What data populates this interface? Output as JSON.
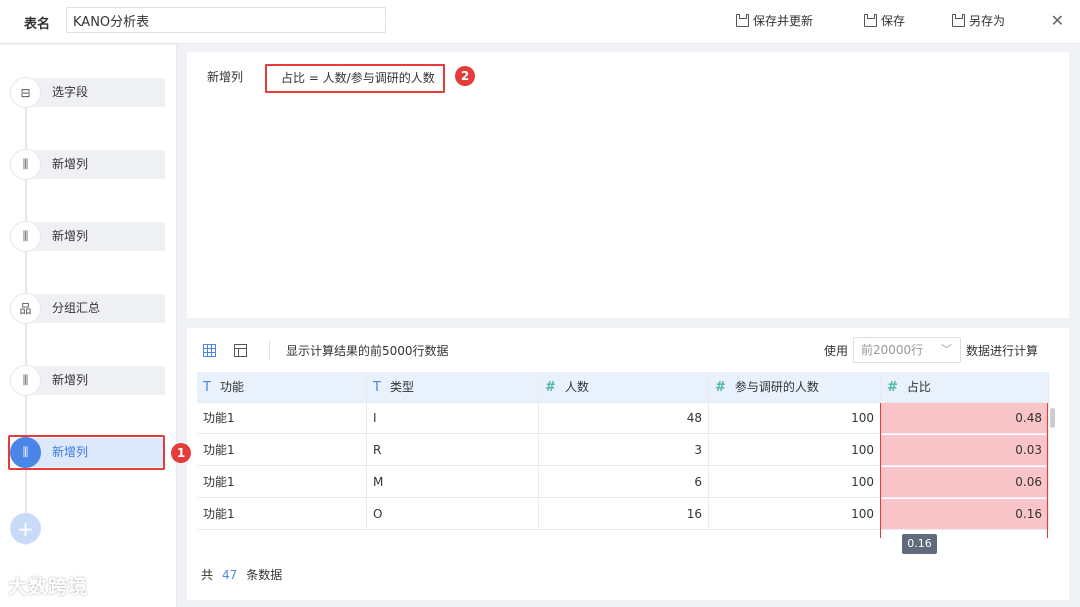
{
  "header": {
    "name_label": "表名",
    "name_value": "KANO分析表",
    "save_update_label": "保存并更新",
    "save_label": "保存",
    "save_as_label": "另存为",
    "close_icon": "close-icon"
  },
  "sidebar": {
    "steps": [
      {
        "label": "选字段",
        "icon": "select-field-icon",
        "glyph": "⊟"
      },
      {
        "label": "新增列",
        "icon": "add-column-icon",
        "glyph": "⫼"
      },
      {
        "label": "新增列",
        "icon": "add-column-icon",
        "glyph": "⫼"
      },
      {
        "label": "分组汇总",
        "icon": "group-summary-icon",
        "glyph": "品"
      },
      {
        "label": "新增列",
        "icon": "add-column-icon",
        "glyph": "⫼"
      },
      {
        "label": "新增列",
        "icon": "add-column-icon",
        "glyph": "⫼",
        "active": true
      }
    ],
    "add_label": "+"
  },
  "badges": [
    "1",
    "2"
  ],
  "formula": {
    "label": "新增列",
    "expression": "占比 = 人数/参与调研的人数"
  },
  "preview": {
    "hint": "显示计算结果的前5000行数据",
    "use_label": "使用",
    "rows_placeholder": "前20000行",
    "calc_label": "数据进行计算",
    "columns": [
      {
        "type": "T",
        "name": "功能"
      },
      {
        "type": "T",
        "name": "类型"
      },
      {
        "type": "#",
        "name": "人数"
      },
      {
        "type": "#",
        "name": "参与调研的人数"
      },
      {
        "type": "#",
        "name": "占比"
      }
    ],
    "rows": [
      [
        "功能1",
        "I",
        "48",
        "100",
        "0.48"
      ],
      [
        "功能1",
        "R",
        "3",
        "100",
        "0.03"
      ],
      [
        "功能1",
        "M",
        "6",
        "100",
        "0.06"
      ],
      [
        "功能1",
        "O",
        "16",
        "100",
        "0.16"
      ]
    ],
    "tooltip": "0.16",
    "footer_prefix": "共",
    "footer_count": "47",
    "footer_suffix": "条数据"
  },
  "watermark": "大数跨境",
  "colors": {
    "accent": "#4a86e8",
    "highlight": "#e63b3b",
    "ratio_fill": "#f9c5c8"
  }
}
